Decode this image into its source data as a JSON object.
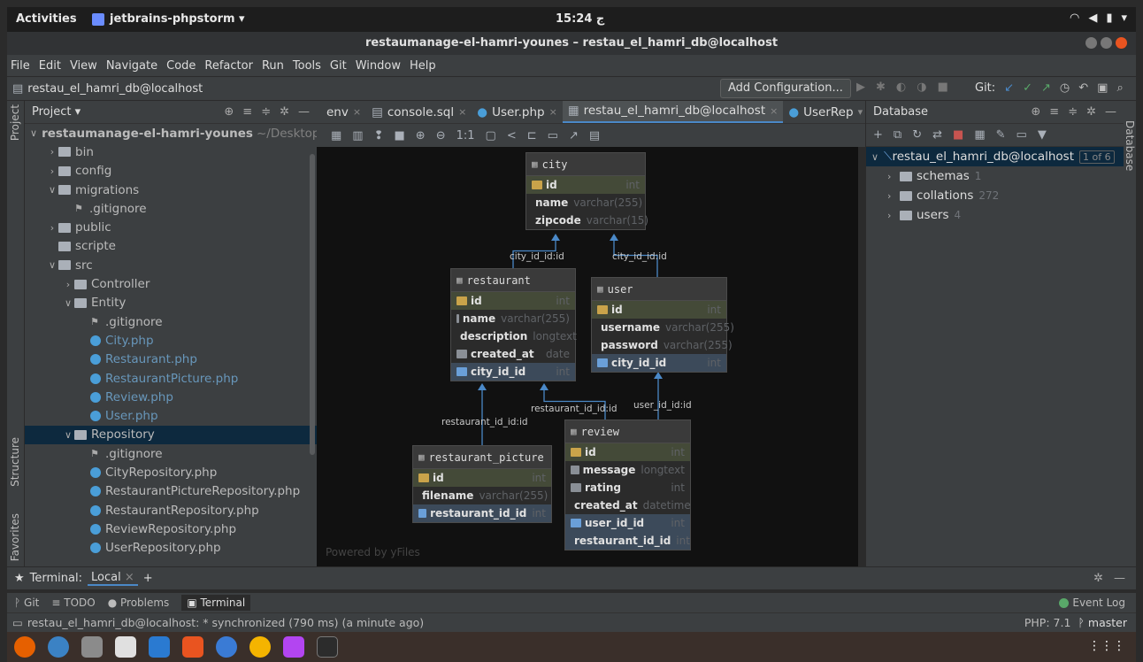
{
  "system": {
    "activities": "Activities",
    "app_name": "jetbrains-phpstorm ▾",
    "clock": "15:24 ج",
    "tray": [
      "▾"
    ]
  },
  "window": {
    "title": "restaumanage-el-hamri-younes – restau_el_hamri_db@localhost"
  },
  "menu": {
    "items": [
      "File",
      "Edit",
      "View",
      "Navigate",
      "Code",
      "Refactor",
      "Run",
      "Tools",
      "Git",
      "Window",
      "Help"
    ]
  },
  "navbar": {
    "breadcrumb": "restau_el_hamri_db@localhost",
    "add_configuration": "Add Configuration...",
    "git_label": "Git:"
  },
  "left_strip": {
    "project": "Project",
    "structure": "Structure",
    "favorites": "Favorites"
  },
  "project_panel": {
    "title": "Project ▾",
    "tree": [
      {
        "label": "restaumanage-el-hamri-younes",
        "suffix": "~/Desktop/",
        "indent": 0,
        "arrow": "∨",
        "type": "folder",
        "bold": true
      },
      {
        "label": "bin",
        "indent": 1,
        "arrow": "›",
        "type": "folder"
      },
      {
        "label": "config",
        "indent": 1,
        "arrow": "›",
        "type": "folder"
      },
      {
        "label": "migrations",
        "indent": 1,
        "arrow": "∨",
        "type": "folder"
      },
      {
        "label": ".gitignore",
        "indent": 2,
        "arrow": "",
        "type": "git"
      },
      {
        "label": "public",
        "indent": 1,
        "arrow": "›",
        "type": "folder"
      },
      {
        "label": "scripte",
        "indent": 1,
        "arrow": "",
        "type": "folder"
      },
      {
        "label": "src",
        "indent": 1,
        "arrow": "∨",
        "type": "folder"
      },
      {
        "label": "Controller",
        "indent": 2,
        "arrow": "›",
        "type": "folder"
      },
      {
        "label": "Entity",
        "indent": 2,
        "arrow": "∨",
        "type": "folder"
      },
      {
        "label": ".gitignore",
        "indent": 3,
        "arrow": "",
        "type": "git"
      },
      {
        "label": "City.php",
        "indent": 3,
        "arrow": "",
        "type": "php",
        "blue": true
      },
      {
        "label": "Restaurant.php",
        "indent": 3,
        "arrow": "",
        "type": "php",
        "blue": true
      },
      {
        "label": "RestaurantPicture.php",
        "indent": 3,
        "arrow": "",
        "type": "php",
        "blue": true
      },
      {
        "label": "Review.php",
        "indent": 3,
        "arrow": "",
        "type": "php",
        "blue": true
      },
      {
        "label": "User.php",
        "indent": 3,
        "arrow": "",
        "type": "php",
        "blue": true
      },
      {
        "label": "Repository",
        "indent": 2,
        "arrow": "∨",
        "type": "folder",
        "selected": true
      },
      {
        "label": ".gitignore",
        "indent": 3,
        "arrow": "",
        "type": "git"
      },
      {
        "label": "CityRepository.php",
        "indent": 3,
        "arrow": "",
        "type": "php"
      },
      {
        "label": "RestaurantPictureRepository.php",
        "indent": 3,
        "arrow": "",
        "type": "php"
      },
      {
        "label": "RestaurantRepository.php",
        "indent": 3,
        "arrow": "",
        "type": "php"
      },
      {
        "label": "ReviewRepository.php",
        "indent": 3,
        "arrow": "",
        "type": "php"
      },
      {
        "label": "UserRepository.php",
        "indent": 3,
        "arrow": "",
        "type": "php"
      }
    ]
  },
  "editor": {
    "tabs": [
      {
        "label": "env",
        "active": false
      },
      {
        "label": "console.sql",
        "active": false
      },
      {
        "label": "User.php",
        "active": false
      },
      {
        "label": "restau_el_hamri_db@localhost",
        "active": true
      },
      {
        "label": "UserRep",
        "active": false
      }
    ],
    "powered_by": "Powered by yFiles"
  },
  "diagram": {
    "tables": [
      {
        "id": "city",
        "name": "city",
        "fields": [
          {
            "name": "id",
            "type": "int",
            "kind": "pk"
          },
          {
            "name": "name",
            "type": "varchar(255)",
            "kind": "col"
          },
          {
            "name": "zipcode",
            "type": "varchar(15)",
            "kind": "col"
          }
        ]
      },
      {
        "id": "restaurant",
        "name": "restaurant",
        "fields": [
          {
            "name": "id",
            "type": "int",
            "kind": "pk"
          },
          {
            "name": "name",
            "type": "varchar(255)",
            "kind": "col"
          },
          {
            "name": "description",
            "type": "longtext",
            "kind": "col"
          },
          {
            "name": "created_at",
            "type": "date",
            "kind": "col"
          },
          {
            "name": "city_id_id",
            "type": "int",
            "kind": "fk"
          }
        ]
      },
      {
        "id": "user",
        "name": "user",
        "fields": [
          {
            "name": "id",
            "type": "int",
            "kind": "pk"
          },
          {
            "name": "username",
            "type": "varchar(255)",
            "kind": "col"
          },
          {
            "name": "password",
            "type": "varchar(255)",
            "kind": "col"
          },
          {
            "name": "city_id_id",
            "type": "int",
            "kind": "fk"
          }
        ]
      },
      {
        "id": "restaurant_picture",
        "name": "restaurant_picture",
        "fields": [
          {
            "name": "id",
            "type": "int",
            "kind": "pk"
          },
          {
            "name": "filename",
            "type": "varchar(255)",
            "kind": "col"
          },
          {
            "name": "restaurant_id_id",
            "type": "int",
            "kind": "fk"
          }
        ]
      },
      {
        "id": "review",
        "name": "review",
        "fields": [
          {
            "name": "id",
            "type": "int",
            "kind": "pk"
          },
          {
            "name": "message",
            "type": "longtext",
            "kind": "col"
          },
          {
            "name": "rating",
            "type": "int",
            "kind": "col"
          },
          {
            "name": "created_at",
            "type": "datetime",
            "kind": "col"
          },
          {
            "name": "user_id_id",
            "type": "int",
            "kind": "fk"
          },
          {
            "name": "restaurant_id_id",
            "type": "int",
            "kind": "fk"
          }
        ]
      }
    ],
    "edges": [
      {
        "from": "restaurant",
        "to": "city",
        "label": "city_id_id:id"
      },
      {
        "from": "user",
        "to": "city",
        "label": "city_id_id:id"
      },
      {
        "from": "restaurant_picture",
        "to": "restaurant",
        "label": "restaurant_id_id:id"
      },
      {
        "from": "review",
        "to": "restaurant",
        "label": "restaurant_id_id:id"
      },
      {
        "from": "review",
        "to": "user",
        "label": "user_id_id:id"
      }
    ]
  },
  "db_panel": {
    "title": "Database",
    "tree": [
      {
        "label": "restau_el_hamri_db@localhost",
        "badge": "1 of 6",
        "indent": 0,
        "arrow": "∨",
        "selected": true
      },
      {
        "label": "schemas",
        "count": "1",
        "indent": 1,
        "arrow": "›"
      },
      {
        "label": "collations",
        "count": "272",
        "indent": 1,
        "arrow": "›"
      },
      {
        "label": "users",
        "count": "4",
        "indent": 1,
        "arrow": "›"
      }
    ],
    "side_label": "Database"
  },
  "terminal": {
    "label": "Terminal:",
    "tab": "Local",
    "add": "+"
  },
  "toolwindows": {
    "items": [
      {
        "label": "Git",
        "active": false
      },
      {
        "label": "TODO",
        "active": false
      },
      {
        "label": "Problems",
        "active": false
      },
      {
        "label": "Terminal",
        "active": true
      }
    ],
    "event_log": "Event Log"
  },
  "status": {
    "message": "restau_el_hamri_db@localhost: * synchronized (790 ms) (a minute ago)",
    "php": "PHP: 7.1",
    "branch": "master"
  },
  "colors": {
    "accent": "#4a88c7",
    "pk": "#c9a34a",
    "fk": "#6a9fd8"
  }
}
